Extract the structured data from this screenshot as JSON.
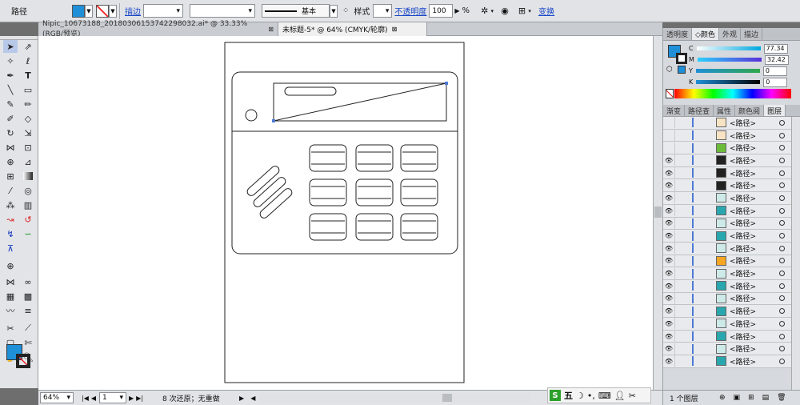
{
  "control_bar": {
    "object_type": "路径",
    "stroke_label": "描边",
    "weight_value": "",
    "profile_label": "基本",
    "style_label": "样式",
    "opacity_label": "不透明度",
    "opacity_value": "100",
    "opacity_unit": "%",
    "transform_label": "变换",
    "fill_color": "#1f8fd8"
  },
  "tabs": [
    {
      "label": "Nipic_10673188_20180306153742298032.ai* @ 33.33% (RGB/预览)",
      "close": "⊠"
    },
    {
      "label": "未标题-5* @ 64% (CMYK/轮廓)",
      "close": "⊠"
    }
  ],
  "status": {
    "zoom": "64%",
    "page": "1",
    "history": "8 次还原；无重做"
  },
  "panel": {
    "tabs": [
      "透明度",
      "◇颜色",
      "外观",
      "描边"
    ],
    "color": {
      "fill": "#1f8fd8",
      "channels": [
        {
          "label": "C",
          "value": "77.34"
        },
        {
          "label": "M",
          "value": "32.42"
        },
        {
          "label": "Y",
          "value": "0"
        },
        {
          "label": "K",
          "value": "0"
        }
      ]
    },
    "layer_tabs": [
      "渐变",
      "路径查",
      "属性",
      "颜色阅",
      "图层"
    ],
    "layer_name": "<路径>",
    "thumb_colors": [
      "#f8e4c4",
      "#f8e4c4",
      "#6dbb3a",
      "#222",
      "#222",
      "#222",
      "#cdeae8",
      "#2aa7ae",
      "#cdeae8",
      "#2aa7ae",
      "#cdeae8",
      "#f5a623",
      "#cdeae8",
      "#2aa7ae",
      "#cdeae8",
      "#2aa7ae",
      "#cdeae8",
      "#2aa7ae",
      "#cdeae8",
      "#2aa7ae"
    ],
    "footer": "1 个图层"
  },
  "ime": {
    "label": "五"
  }
}
